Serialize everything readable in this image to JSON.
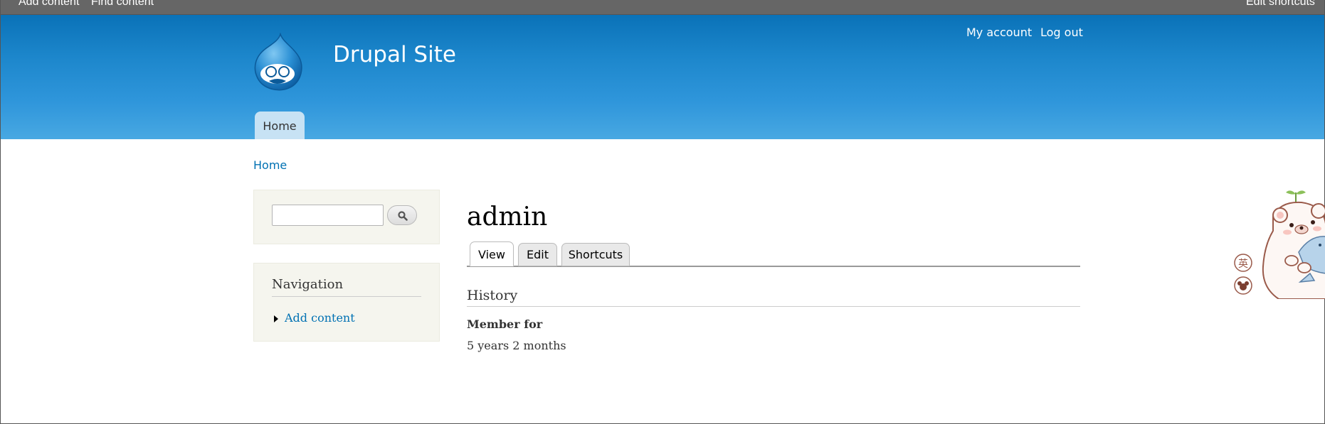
{
  "toolbar": {
    "add_content": "Add content",
    "find_content": "Find content",
    "edit_shortcuts": "Edit shortcuts"
  },
  "header": {
    "site_name": "Drupal Site",
    "logo_icon": "drupal-drop-icon",
    "secondary_menu": {
      "my_account": "My account",
      "log_out": "Log out"
    },
    "primary_tabs": [
      {
        "label": "Home"
      }
    ]
  },
  "breadcrumb": {
    "home": "Home"
  },
  "sidebar": {
    "search": {
      "input_value": "",
      "button_icon": "search-icon"
    },
    "navigation": {
      "title": "Navigation",
      "items": [
        {
          "label": "Add content"
        }
      ]
    }
  },
  "main": {
    "title": "admin",
    "tabs": [
      {
        "label": "View",
        "active": true
      },
      {
        "label": "Edit",
        "active": false
      },
      {
        "label": "Shortcuts",
        "active": false
      }
    ],
    "history": {
      "title": "History",
      "member_for_label": "Member for",
      "member_for_value": "5 years 2 months"
    }
  },
  "decoration": {
    "mascot_icon": "bear-mascot-icon",
    "badge_char": "英"
  },
  "colors": {
    "header_top": "#0a72b8",
    "header_bottom": "#48a8e2",
    "link": "#0071b3",
    "toolbar": "#666666",
    "block_bg": "#f5f5ee"
  }
}
